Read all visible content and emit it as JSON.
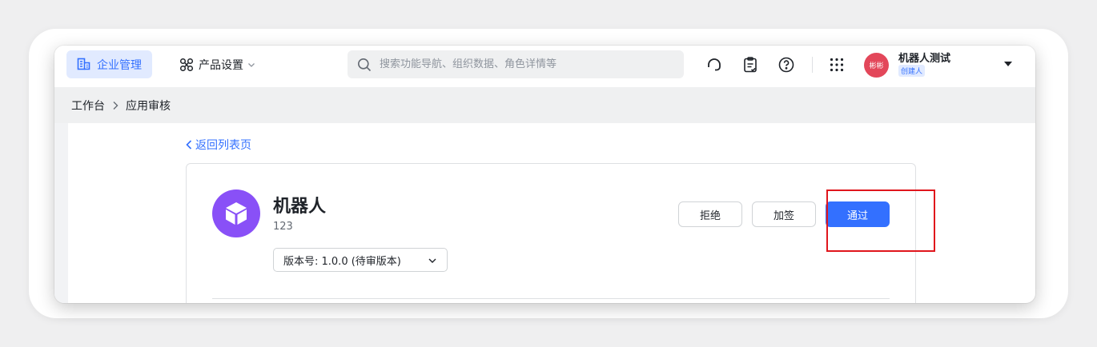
{
  "topbar": {
    "org_label": "企业管理",
    "product_label": "产品设置",
    "search_placeholder": "搜索功能导航、组织数据、角色详情等"
  },
  "user": {
    "avatar_text": "彬彬",
    "name": "机器人测试",
    "role": "创建人"
  },
  "breadcrumb": {
    "home": "工作台",
    "current": "应用审核"
  },
  "back_link": "返回列表页",
  "app": {
    "name": "机器人",
    "description": "123",
    "version_selected": "版本号: 1.0.0 (待审版本)"
  },
  "actions": {
    "reject": "拒绝",
    "add_signer": "加签",
    "approve": "通过"
  },
  "colors": {
    "accent": "#3370ff",
    "app_icon": "#8950f7",
    "avatar": "#e3475a",
    "highlight": "#e0161c"
  },
  "icons": {
    "org": "building-icon",
    "product": "product-settings-icon",
    "search": "search-icon",
    "support": "headset-icon",
    "todo": "clipboard-icon",
    "help": "help-icon",
    "apps": "grid-dots-icon",
    "caret": "caret-down-icon",
    "app": "cube-icon"
  }
}
